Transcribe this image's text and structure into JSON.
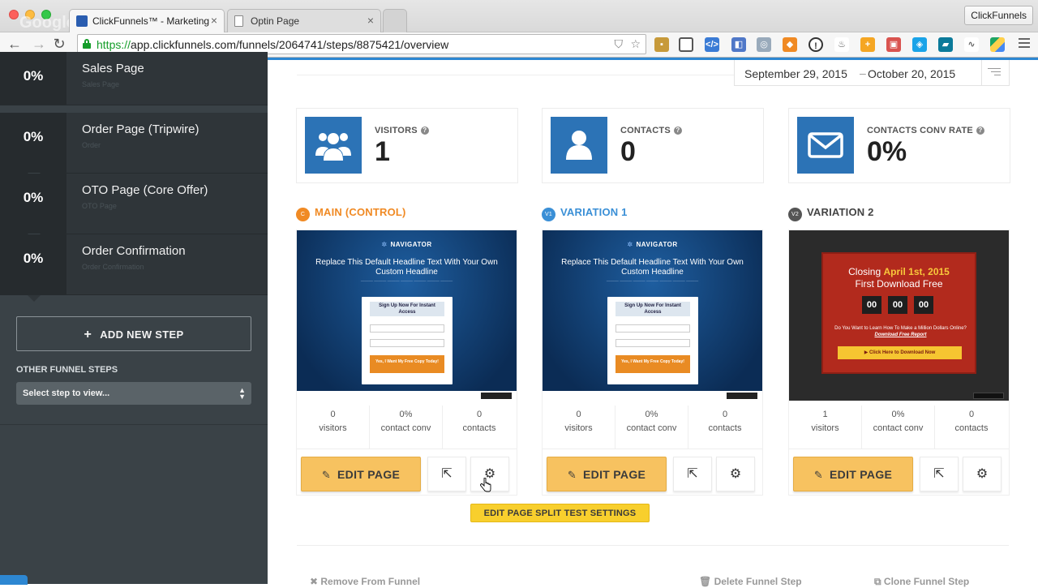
{
  "browser": {
    "tabs": [
      {
        "title": "ClickFunnels™ - Marketing",
        "active": true
      },
      {
        "title": "Optin Page",
        "active": false
      }
    ],
    "url_scheme": "https://",
    "url_rest": "app.clickfunnels.com/funnels/2064741/steps/8875421/overview",
    "profile_label": "ClickFunnels",
    "watermark": "Google"
  },
  "sidebar": {
    "steps": [
      {
        "percent": "0%",
        "name": "Sales Page",
        "sub": "Sales Page"
      },
      {
        "percent": "0%",
        "name": "Order Page (Tripwire)",
        "sub": "Order"
      },
      {
        "percent": "0%",
        "name": "OTO Page (Core Offer)",
        "sub": "OTO Page"
      },
      {
        "percent": "0%",
        "name": "Order Confirmation",
        "sub": "Order Confirmation"
      }
    ],
    "add_step_label": "ADD NEW STEP",
    "other_steps_label": "OTHER FUNNEL STEPS",
    "select_placeholder": "Select step to view..."
  },
  "date_range": {
    "start": "September 29, 2015",
    "end": "October 20, 2015",
    "separator": "–"
  },
  "stats": [
    {
      "label": "VISITORS",
      "value": "1",
      "icon": "users-icon"
    },
    {
      "label": "CONTACTS",
      "value": "0",
      "icon": "user-icon"
    },
    {
      "label": "CONTACTS CONV RATE",
      "value": "0%",
      "icon": "envelope-icon"
    }
  ],
  "variations": [
    {
      "badge": "C",
      "title": "MAIN (CONTROL)",
      "color": "#f08a24",
      "visitors_num": "0",
      "visitors_label": "visitors",
      "conv_num": "0%",
      "conv_label": "contact conv",
      "contacts_num": "0",
      "contacts_label": "contacts",
      "edit_label": "EDIT PAGE"
    },
    {
      "badge": "V1",
      "title": "VARIATION 1",
      "color": "#3a8fd6",
      "visitors_num": "0",
      "visitors_label": "visitors",
      "conv_num": "0%",
      "conv_label": "contact conv",
      "contacts_num": "0",
      "contacts_label": "contacts",
      "edit_label": "EDIT PAGE"
    },
    {
      "badge": "V2",
      "title": "VARIATION 2",
      "color": "#555555",
      "visitors_num": "1",
      "visitors_label": "visitors",
      "conv_num": "0%",
      "conv_label": "contact conv",
      "contacts_num": "0",
      "contacts_label": "contacts",
      "edit_label": "EDIT PAGE"
    }
  ],
  "preview_nav": {
    "logo": "NAVIGATOR",
    "headline": "Replace This Default Headline Text With Your Own Custom Headline",
    "form_head": "Sign Up Now For Instant Access",
    "cta": "Yes, I Want My Free Copy Today!"
  },
  "preview_countdown": {
    "title_pre": "Closing ",
    "title_date": "April 1st, 2015",
    "title_line2": "First Download Free",
    "boxes": [
      "00",
      "00",
      "00"
    ],
    "question": "Do You Want to Learn How To Make a Million Dollars Online?",
    "question_link": "Download Free Report",
    "button": "Click Here to Download Now"
  },
  "split_test_label": "EDIT PAGE SPLIT TEST SETTINGS",
  "bottom_links": {
    "remove": "Remove From Funnel",
    "delete": "Delete Funnel Step",
    "clone": "Clone Funnel Step"
  }
}
